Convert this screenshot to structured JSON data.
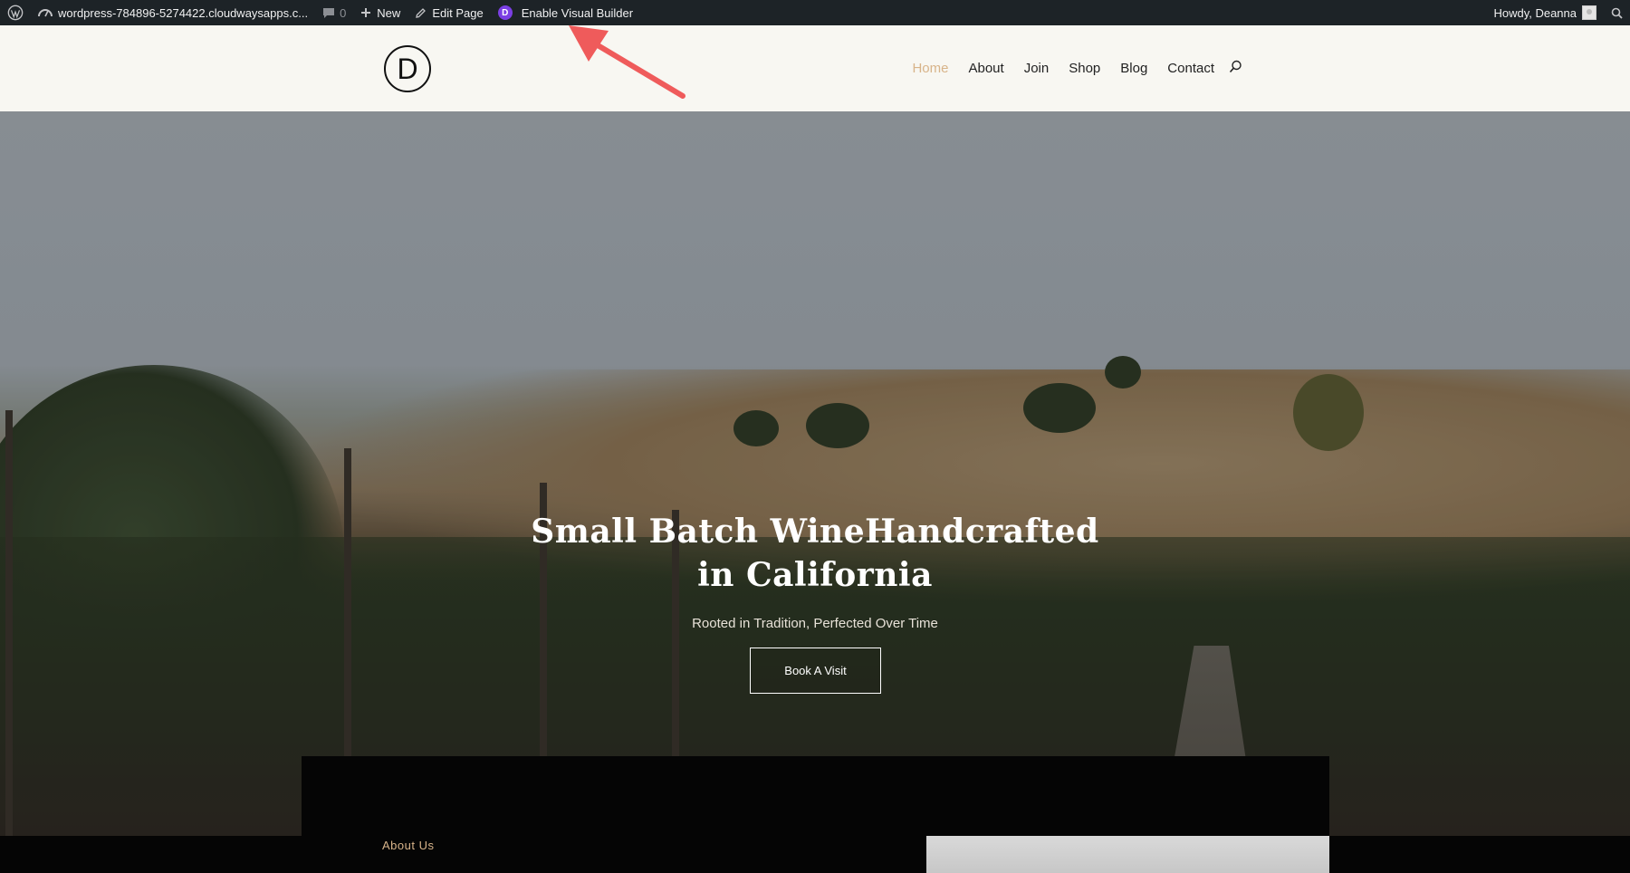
{
  "adminbar": {
    "site_url": "wordpress-784896-5274422.cloudwaysapps.c...",
    "comments_count": "0",
    "new_label": "New",
    "edit_label": "Edit Page",
    "visual_builder_label": "Enable Visual Builder",
    "divi_badge": "D",
    "howdy_label": "Howdy, Deanna"
  },
  "header": {
    "logo_letter": "D",
    "nav": [
      "Home",
      "About",
      "Join",
      "Shop",
      "Blog",
      "Contact"
    ],
    "active_item": "Home"
  },
  "hero": {
    "title_line1": "Small Batch WineHandcrafted",
    "title_line2": "in California",
    "subtitle": "Rooted in Tradition, Perfected Over Time",
    "button_label": "Book A Visit"
  },
  "about": {
    "label": "About Us"
  },
  "colors": {
    "adminbar_bg": "#1d2327",
    "header_bg": "#f8f7f2",
    "accent_gold": "#d8b48a",
    "divi_purple": "#7b3fe4",
    "annotation_arrow": "#ef5b5b"
  },
  "icons": [
    "wordpress-icon",
    "dashboard-icon",
    "comment-icon",
    "plus-icon",
    "pencil-icon",
    "divi-icon",
    "avatar",
    "search-icon"
  ]
}
